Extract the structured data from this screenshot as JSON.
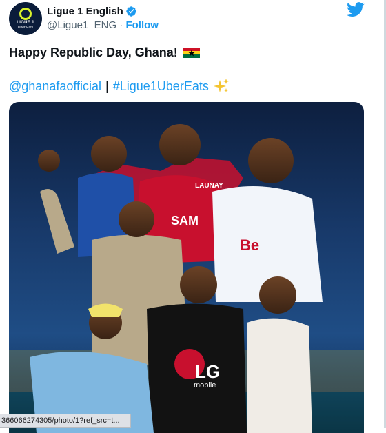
{
  "account": {
    "display_name": "Ligue 1 English",
    "handle": "@Ligue1_ENG",
    "separator": "·",
    "follow_label": "Follow",
    "avatar_logo_text": "LIGUE 1",
    "avatar_logo_sub": "Uber Eats"
  },
  "tweet": {
    "line1": "Happy Republic Day, Ghana!",
    "mention": "@ghanafaofficial",
    "divider": "|",
    "hashtag": "#Ligue1UberEats"
  },
  "media": {
    "sponsor_text": "LG",
    "sponsor_sub": "mobile",
    "jersey_sponsor_1": "SAM",
    "jersey_sponsor_2": "LAUNAY",
    "jersey_sponsor_3": "Be"
  },
  "status_bar": {
    "url": "366066274305/photo/1?ref_src=t..."
  },
  "icons": [
    "verified-badge-icon",
    "twitter-bird-icon",
    "ghana-flag-icon",
    "sparkles-icon"
  ],
  "colors": {
    "link": "#1d9bf0",
    "text": "#0f1419",
    "secondary": "#536471",
    "ghana_red": "#ce1126",
    "ghana_gold": "#fcd116",
    "ghana_green": "#006b3f"
  }
}
